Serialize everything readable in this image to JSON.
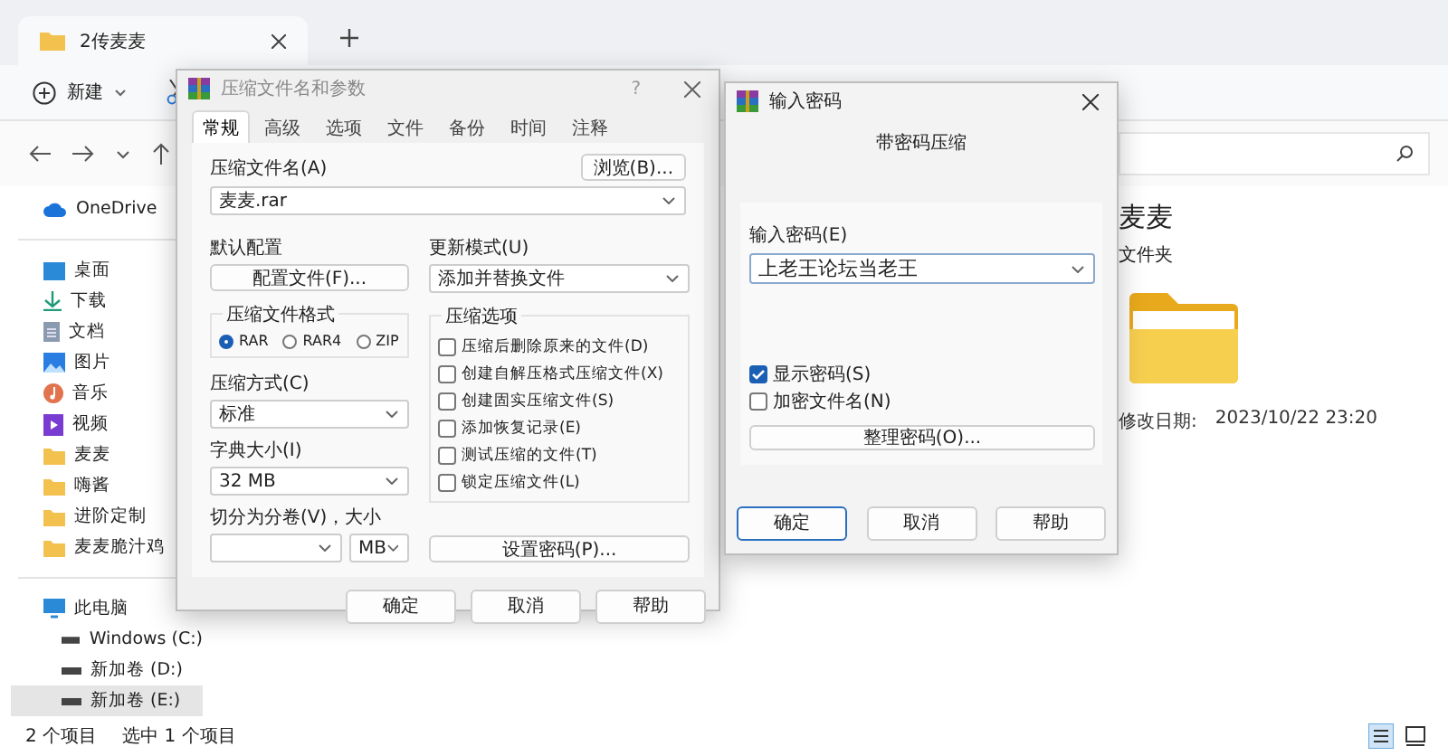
{
  "explorer": {
    "tab": {
      "title": "2传麦麦"
    },
    "toolbar": {
      "new_label": "新建"
    },
    "sidebar": {
      "items": [
        {
          "kind": "cloud",
          "label": "OneDrive",
          "selected": false
        },
        {
          "kind": "desktop",
          "label": "桌面",
          "selected": false
        },
        {
          "kind": "download",
          "label": "下载",
          "selected": false
        },
        {
          "kind": "docs",
          "label": "文档",
          "selected": false
        },
        {
          "kind": "pictures",
          "label": "图片",
          "selected": false
        },
        {
          "kind": "music",
          "label": "音乐",
          "selected": false
        },
        {
          "kind": "video",
          "label": "视频",
          "selected": false
        },
        {
          "kind": "folder",
          "label": "麦麦",
          "selected": false
        },
        {
          "kind": "folder",
          "label": "嗨酱",
          "selected": false
        },
        {
          "kind": "folder",
          "label": "进阶定制",
          "selected": false
        },
        {
          "kind": "folder",
          "label": "麦麦脆汁鸡",
          "selected": false
        },
        {
          "kind": "pc",
          "label": "此电脑",
          "selected": false
        },
        {
          "kind": "drive",
          "label": "Windows (C:)",
          "selected": false
        },
        {
          "kind": "drive",
          "label": "新加卷 (D:)",
          "selected": false
        },
        {
          "kind": "drive",
          "label": "新加卷 (E:)",
          "selected": true
        }
      ]
    },
    "details": {
      "name": "麦麦",
      "type": "文件夹",
      "modified_label": "修改日期:",
      "modified": "2023/10/22 23:20"
    },
    "status_bar": {
      "count": "2 个项目",
      "selection": "选中 1 个项目"
    }
  },
  "archive_dialog": {
    "title": "压缩文件名和参数",
    "help": "?",
    "tabs": [
      {
        "label": "常规",
        "selected": true
      },
      {
        "label": "高级",
        "selected": false
      },
      {
        "label": "选项",
        "selected": false
      },
      {
        "label": "文件",
        "selected": false
      },
      {
        "label": "备份",
        "selected": false
      },
      {
        "label": "时间",
        "selected": false
      },
      {
        "label": "注释",
        "selected": false
      }
    ],
    "archive_name_label": "压缩文件名(A)",
    "browse_button": "浏览(B)...",
    "archive_name": "麦麦.rar",
    "profiles_label": "默认配置",
    "profiles_button": "配置文件(F)...",
    "update_mode_label": "更新模式(U)",
    "update_mode": "添加并替换文件",
    "format_group": "压缩文件格式",
    "formats": [
      {
        "label": "RAR",
        "selected": true
      },
      {
        "label": "RAR4",
        "selected": false
      },
      {
        "label": "ZIP",
        "selected": false
      }
    ],
    "options_group": "压缩选项",
    "options": [
      {
        "label": "压缩后删除原来的文件(D)",
        "checked": false
      },
      {
        "label": "创建自解压格式压缩文件(X)",
        "checked": false
      },
      {
        "label": "创建固实压缩文件(S)",
        "checked": false
      },
      {
        "label": "添加恢复记录(E)",
        "checked": false
      },
      {
        "label": "测试压缩的文件(T)",
        "checked": false
      },
      {
        "label": "锁定压缩文件(L)",
        "checked": false
      }
    ],
    "method_label": "压缩方式(C)",
    "method": "标准",
    "dict_label": "字典大小(I)",
    "dict": "32 MB",
    "split_label": "切分为分卷(V)，大小",
    "split_unit": "MB",
    "password_button": "设置密码(P)...",
    "buttons": [
      "确定",
      "取消",
      "帮助"
    ]
  },
  "password_dialog": {
    "title": "输入密码",
    "heading": "带密码压缩",
    "password_label": "输入密码(E)",
    "password": "上老王论坛当老王",
    "options": [
      {
        "label": "显示密码(S)",
        "checked": true
      },
      {
        "label": "加密文件名(N)",
        "checked": false
      }
    ],
    "organize_button": "整理密码(O)...",
    "buttons": [
      {
        "label": "确定",
        "default": true
      },
      {
        "label": "取消",
        "default": false
      },
      {
        "label": "帮助",
        "default": false
      }
    ]
  }
}
